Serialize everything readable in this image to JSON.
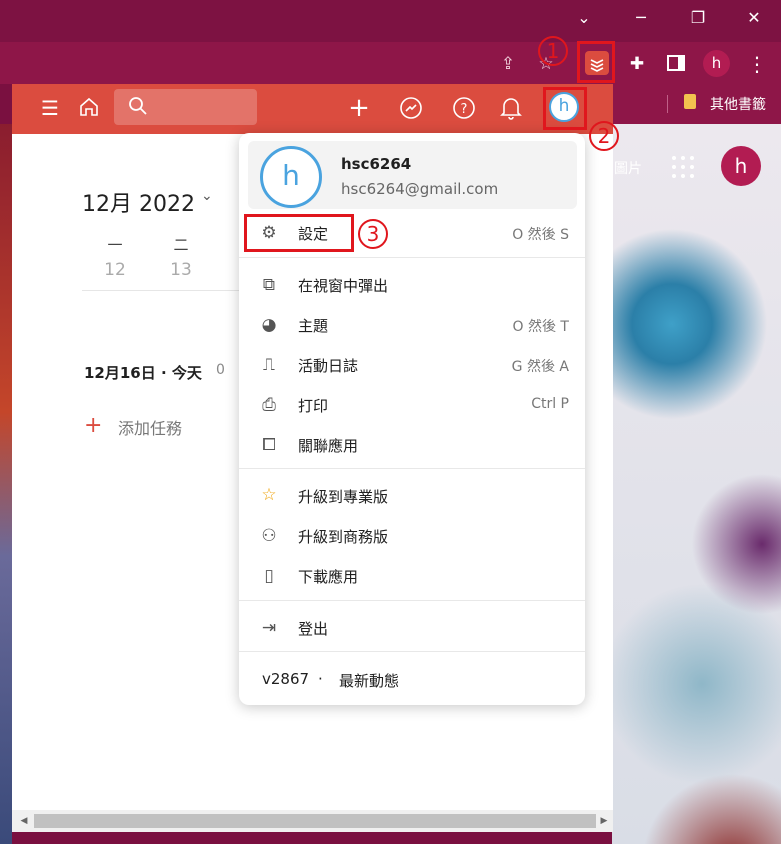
{
  "browser": {
    "window_controls": {
      "minimize": "─",
      "restore": "❐",
      "close": "✕",
      "chevron": "⌄"
    },
    "bookmark_folder": "其他書籤",
    "profile_initial": "h",
    "wallpaper_label": "圖片"
  },
  "app": {
    "header": {
      "avatar_initial": "h"
    },
    "calendar": {
      "month_label": "12月 2022",
      "weekdays": [
        "一",
        "二"
      ],
      "days": [
        "12",
        "13"
      ]
    },
    "today_section": {
      "label": "12月16日 · 今天",
      "count": "0"
    },
    "add_task_label": "添加任務"
  },
  "menu": {
    "profile": {
      "initial": "h",
      "name": "hsc6264",
      "email": "hsc6264@gmail.com"
    },
    "items": [
      {
        "label": "設定",
        "shortcut": "O 然後 S",
        "icon": "gear-icon"
      },
      {
        "label": "在視窗中彈出",
        "shortcut": "",
        "icon": "popout-icon"
      },
      {
        "label": "主題",
        "shortcut": "O 然後 T",
        "icon": "palette-icon"
      },
      {
        "label": "活動日誌",
        "shortcut": "G 然後 A",
        "icon": "activity-icon"
      },
      {
        "label": "打印",
        "shortcut": "Ctrl P",
        "icon": "printer-icon"
      },
      {
        "label": "關聯應用",
        "shortcut": "",
        "icon": "puzzle-icon"
      },
      {
        "label": "升級到專業版",
        "shortcut": "",
        "icon": "star-icon"
      },
      {
        "label": "升級到商務版",
        "shortcut": "",
        "icon": "users-icon"
      },
      {
        "label": "下載應用",
        "shortcut": "",
        "icon": "phone-icon"
      },
      {
        "label": "登出",
        "shortcut": "",
        "icon": "logout-icon"
      }
    ],
    "version": "v2867",
    "separator": "·",
    "whats_new": "最新動態"
  },
  "annotations": {
    "one": "1",
    "two": "2",
    "three": "3"
  },
  "colors": {
    "header": "#db4c3f",
    "accent_blue": "#4aa3df",
    "annotation_red": "#e0161d",
    "browser_frame": "#8e1648"
  }
}
